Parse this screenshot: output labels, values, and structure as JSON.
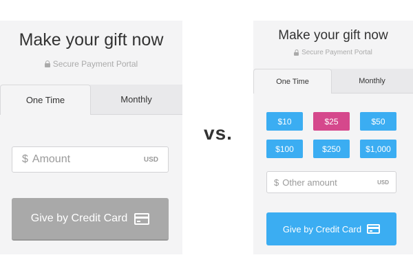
{
  "left": {
    "title": "Make your gift now",
    "subtitle": "Secure Payment Portal",
    "tabs": [
      {
        "label": "One Time",
        "active": true
      },
      {
        "label": "Monthly",
        "active": false
      }
    ],
    "amount_field": {
      "currency_symbol": "$",
      "placeholder": "Amount",
      "currency_code": "USD"
    },
    "submit_button": {
      "label": "Give by Credit Card",
      "color": "#a9a9a9"
    }
  },
  "vs_label": "vs.",
  "right": {
    "title": "Make your gift now",
    "subtitle": "Secure Payment Portal",
    "tabs": [
      {
        "label": "One Time",
        "active": true
      },
      {
        "label": "Monthly",
        "active": false
      }
    ],
    "amounts": [
      {
        "label": "$10",
        "selected": false
      },
      {
        "label": "$25",
        "selected": true
      },
      {
        "label": "$50",
        "selected": false
      },
      {
        "label": "$100",
        "selected": false
      },
      {
        "label": "$250",
        "selected": false
      },
      {
        "label": "$1,000",
        "selected": false
      }
    ],
    "amount_field": {
      "currency_symbol": "$",
      "placeholder": "Other amount",
      "currency_code": "USD"
    },
    "submit_button": {
      "label": "Give by Credit Card",
      "color": "#3badf2"
    },
    "colors": {
      "amount_default": "#3badf2",
      "amount_selected": "#d5488c"
    }
  }
}
